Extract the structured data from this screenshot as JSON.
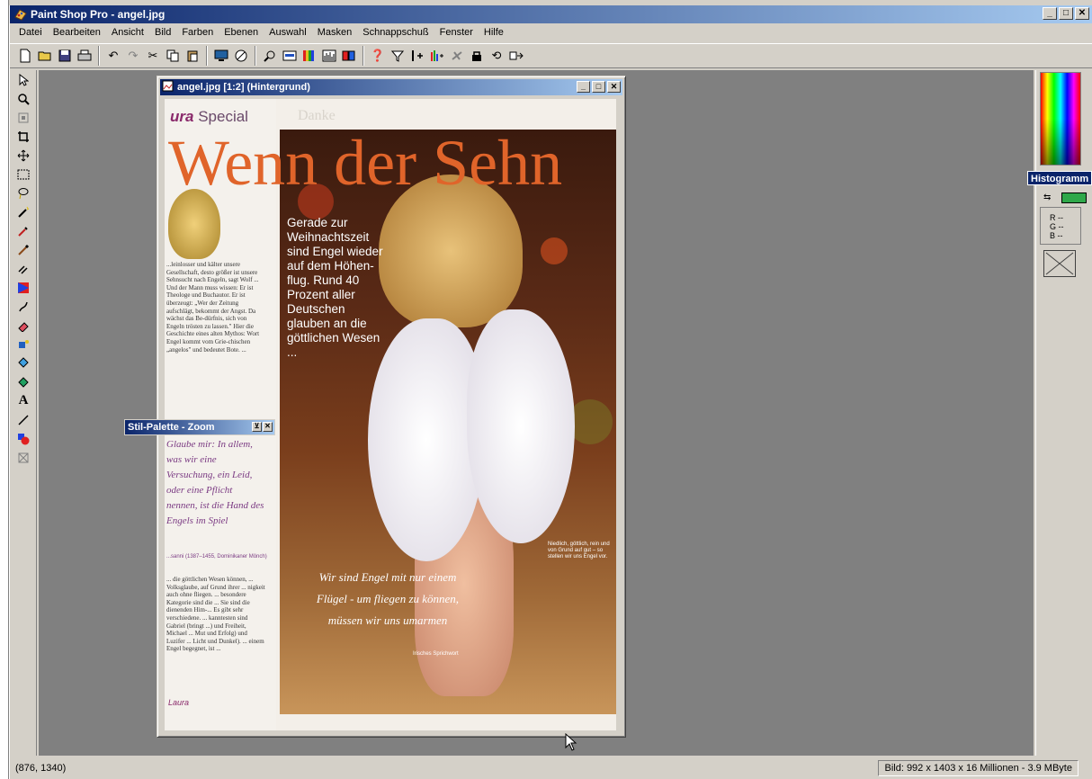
{
  "window": {
    "title": "Paint Shop Pro - angel.jpg",
    "minimize": "_",
    "maximize": "□",
    "close": "✕"
  },
  "menu": [
    "Datei",
    "Bearbeiten",
    "Ansicht",
    "Bild",
    "Farben",
    "Ebenen",
    "Auswahl",
    "Masken",
    "Schnappschuß",
    "Fenster",
    "Hilfe"
  ],
  "image_window": {
    "title": "angel.jpg [1:2] (Hintergrund)",
    "minimize": "_",
    "maximize": "□",
    "close": "✕"
  },
  "stil_palette": {
    "title": "Stil-Palette - Zoom",
    "pin": "⊻",
    "close": "✕"
  },
  "histogram_tab": "Histogramm",
  "rgb_readout": {
    "r": "R --",
    "g": "G --",
    "b": "B --"
  },
  "status": {
    "coords": "(876, 1340)",
    "image_info": "Bild:  992 x 1403 x 16 Millionen - 3.9 MByte"
  },
  "colors": {
    "foreground_swatch": "#2fa84a",
    "titlebar_start": "#0a246a",
    "titlebar_end": "#a6caf0"
  },
  "magazine": {
    "brand_script": "ura",
    "brand_word": "Special",
    "ghost": "Danke",
    "headline": "Wenn der Sehn",
    "deck": "Gerade zur Weihnachtszeit sind Engel wieder auf dem Höhen-flug. Rund 40 Prozent aller Deutschen glauben an die göttlichen Wesen ...",
    "caption": "Niedlich, göttlich, rein und von Grund auf gut – so stellen wir uns Engel vor.",
    "quote": "Wir sind Engel mit nur einem Flügel - um fliegen zu können, müssen wir uns umarmen",
    "credit": "Irisches Sprichwort",
    "col1": "...leinlosser und kälter unsere Gesellschaft, desto größer ist unsere Sehnsucht nach Engeln, sagt Wolf ... Und der Mann muss wissen: Er ist Theologe und Buchautor. Er ist überzeugt: „Wer der Zeitung aufschlägt, bekommt der Angst. Da wächst das Be-dürfnis, sich von Engeln trösten zu lassen.\" Hier die Geschichte eines alten Mythos: Wort Engel kommt vom Grie-chischen „angelos\" und bedeutet Bote. ...",
    "purple_quote": "Glaube mir: In allem, was wir eine Versuchung, ein Leid, oder eine Pflicht nennen, ist die Hand des Engels im Spiel",
    "attribution": "...sanni (1387–1455, Dominikaner Mönch)",
    "col2": "... die göttlichen Wesen können, ... Volksglaube, auf Grund ihrer ... nigkeit auch ohne fliegen. ... besondere Kategorie sind die ... Sie sind die dienenden Him-... Es gibt sehr verschiedene. ... kanntesten sind Gabriel (bringt ...) und Freiheit, Michael ... Mut und Erfolg) und Luzifer ... Licht und Dunkel). ... einem Engel begegnet, ist ...",
    "footer": "Laura"
  }
}
